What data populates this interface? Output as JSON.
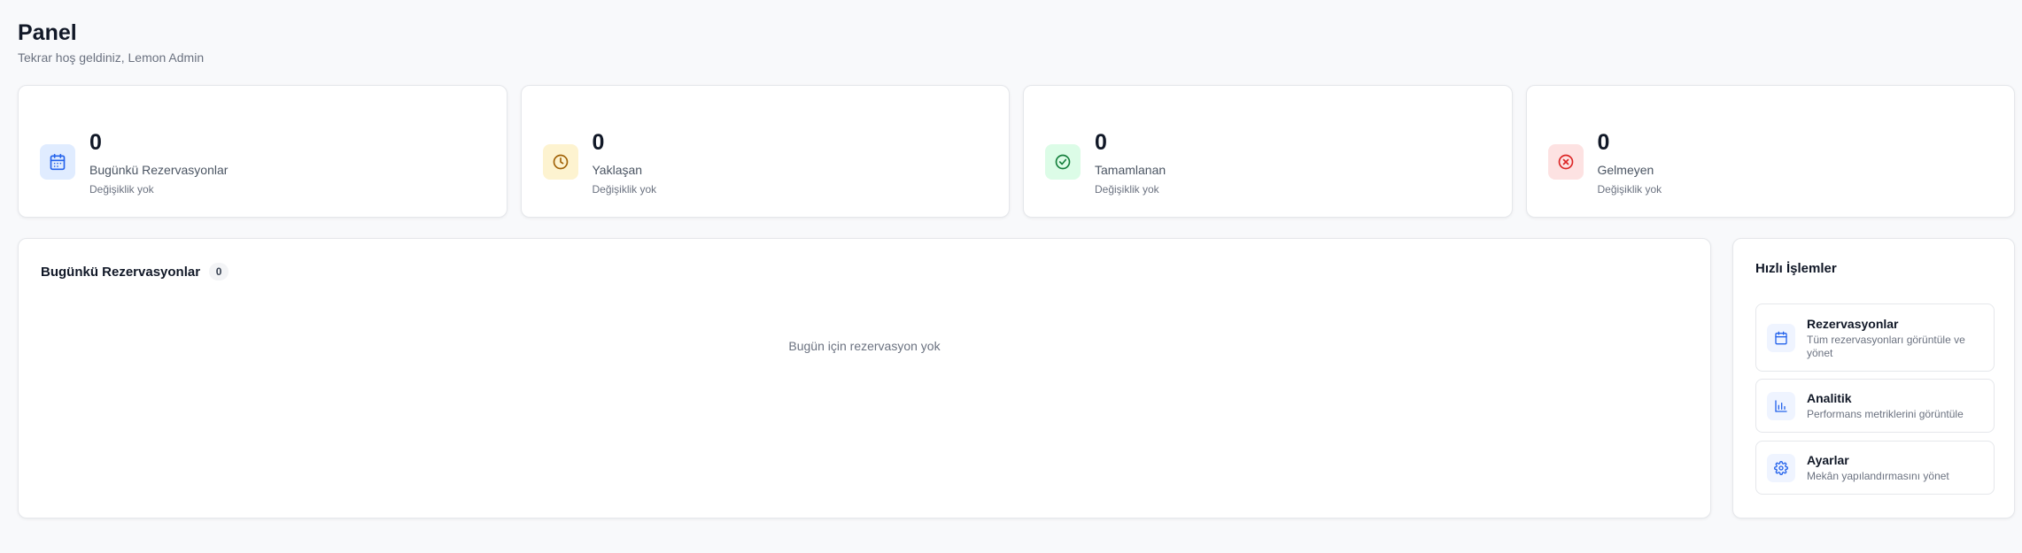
{
  "header": {
    "title": "Panel",
    "subtitle": "Tekrar hoş geldiniz, Lemon Admin"
  },
  "stats": [
    {
      "value": "0",
      "label": "Bugünkü Rezervasyonlar",
      "change": "Değişiklik yok",
      "icon": "calendar-icon",
      "bg": "#e0ecff",
      "color": "#2563eb"
    },
    {
      "value": "0",
      "label": "Yaklaşan",
      "change": "Değişiklik yok",
      "icon": "clock-icon",
      "bg": "#fdf3d0",
      "color": "#a16207"
    },
    {
      "value": "0",
      "label": "Tamamlanan",
      "change": "Değişiklik yok",
      "icon": "check-circle-icon",
      "bg": "#dcfce7",
      "color": "#15803d"
    },
    {
      "value": "0",
      "label": "Gelmeyen",
      "change": "Değişiklik yok",
      "icon": "x-circle-icon",
      "bg": "#fde2e2",
      "color": "#dc2626"
    }
  ],
  "main": {
    "title": "Bugünkü Rezervasyonlar",
    "count": "0",
    "empty_text": "Bugün için rezervasyon yok"
  },
  "quick": {
    "title": "Hızlı İşlemler",
    "items": [
      {
        "title": "Rezervasyonlar",
        "desc": "Tüm rezervasyonları görüntüle ve yönet",
        "icon": "calendar-icon"
      },
      {
        "title": "Analitik",
        "desc": "Performans metriklerini görüntüle",
        "icon": "bar-chart-icon"
      },
      {
        "title": "Ayarlar",
        "desc": "Mekân yapılandırmasını yönet",
        "icon": "gear-icon"
      }
    ]
  },
  "colors": {
    "accent": "#2563eb",
    "border": "#e5e7eb",
    "background": "#f8f9fb"
  }
}
